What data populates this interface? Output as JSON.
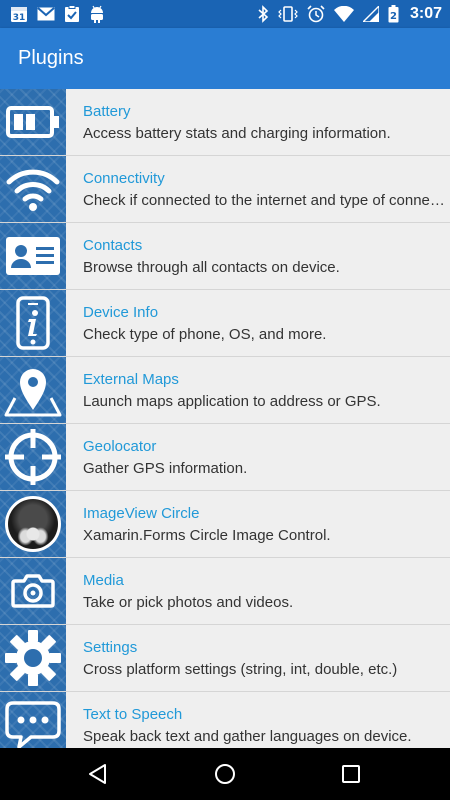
{
  "status_bar": {
    "calendar_day": "31",
    "time": "3:07",
    "battery_mark": "2"
  },
  "app_bar": {
    "title": "Plugins"
  },
  "plugins": [
    {
      "title": "Battery",
      "subtitle": "Access battery stats and charging information.",
      "icon": "battery-icon"
    },
    {
      "title": "Connectivity",
      "subtitle": "Check if connected to the internet and type of connection.",
      "icon": "wifi-icon"
    },
    {
      "title": "Contacts",
      "subtitle": "Browse through all contacts on device.",
      "icon": "contact-card-icon"
    },
    {
      "title": "Device Info",
      "subtitle": "Check type of phone, OS, and more.",
      "icon": "device-info-icon"
    },
    {
      "title": "External Maps",
      "subtitle": "Launch maps application to address or GPS.",
      "icon": "map-pin-icon"
    },
    {
      "title": "Geolocator",
      "subtitle": "Gather GPS information.",
      "icon": "crosshair-icon"
    },
    {
      "title": "ImageView Circle",
      "subtitle": "Xamarin.Forms Circle Image Control.",
      "icon": "circle-photo"
    },
    {
      "title": "Media",
      "subtitle": "Take or pick photos and videos.",
      "icon": "camera-icon"
    },
    {
      "title": "Settings",
      "subtitle": "Cross platform settings (string, int, double, etc.)",
      "icon": "gear-icon"
    },
    {
      "title": "Text to Speech",
      "subtitle": "Speak back text and gather languages on device.",
      "icon": "speech-bubble-icon"
    }
  ],
  "colors": {
    "status_bar": "#1a64b4",
    "app_bar": "#2a7dd3",
    "tile": "#2d6eae",
    "title_text": "#2199d8",
    "list_bg": "#efefef"
  }
}
